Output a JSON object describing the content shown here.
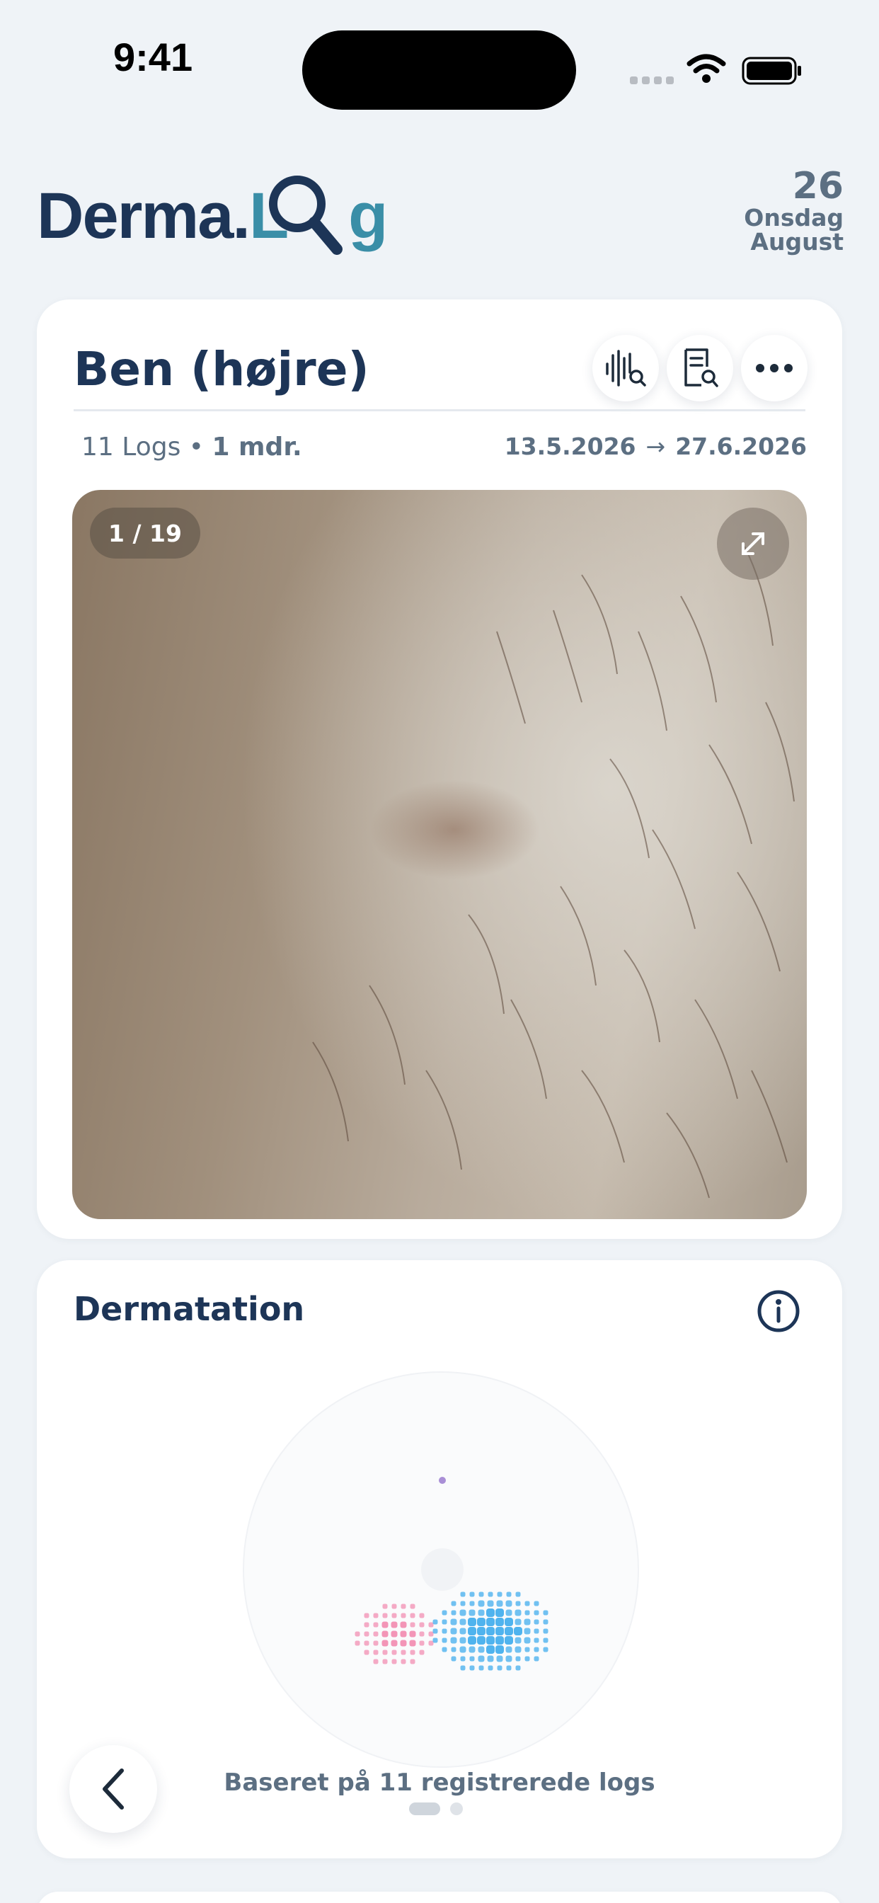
{
  "status_bar": {
    "time": "9:41"
  },
  "header": {
    "logo_part1": "Derma.",
    "logo_part2": "L",
    "logo_part3": "g",
    "date_day": "26",
    "date_weekday": "Onsdag",
    "date_month": "August"
  },
  "entry": {
    "title": "Ben (højre)",
    "log_count": "11",
    "log_label": "Logs",
    "duration": "1 mdr.",
    "start_date": "13.5.2026",
    "arrow": "→",
    "end_date": "27.6.2026",
    "photo_counter": "1 / 19"
  },
  "dermatation": {
    "title": "Dermatation",
    "footnote": "Baseret på 11 registrerede logs",
    "pink_color": "#f28fb3",
    "blue_color": "#4fb3ee",
    "dot_color": "#a98fd6"
  },
  "icons": {
    "analyze": "waveform-search-icon",
    "report": "document-search-icon",
    "more": "ellipsis-icon",
    "expand": "expand-icon",
    "info": "info-icon",
    "back": "chevron-left-icon"
  }
}
